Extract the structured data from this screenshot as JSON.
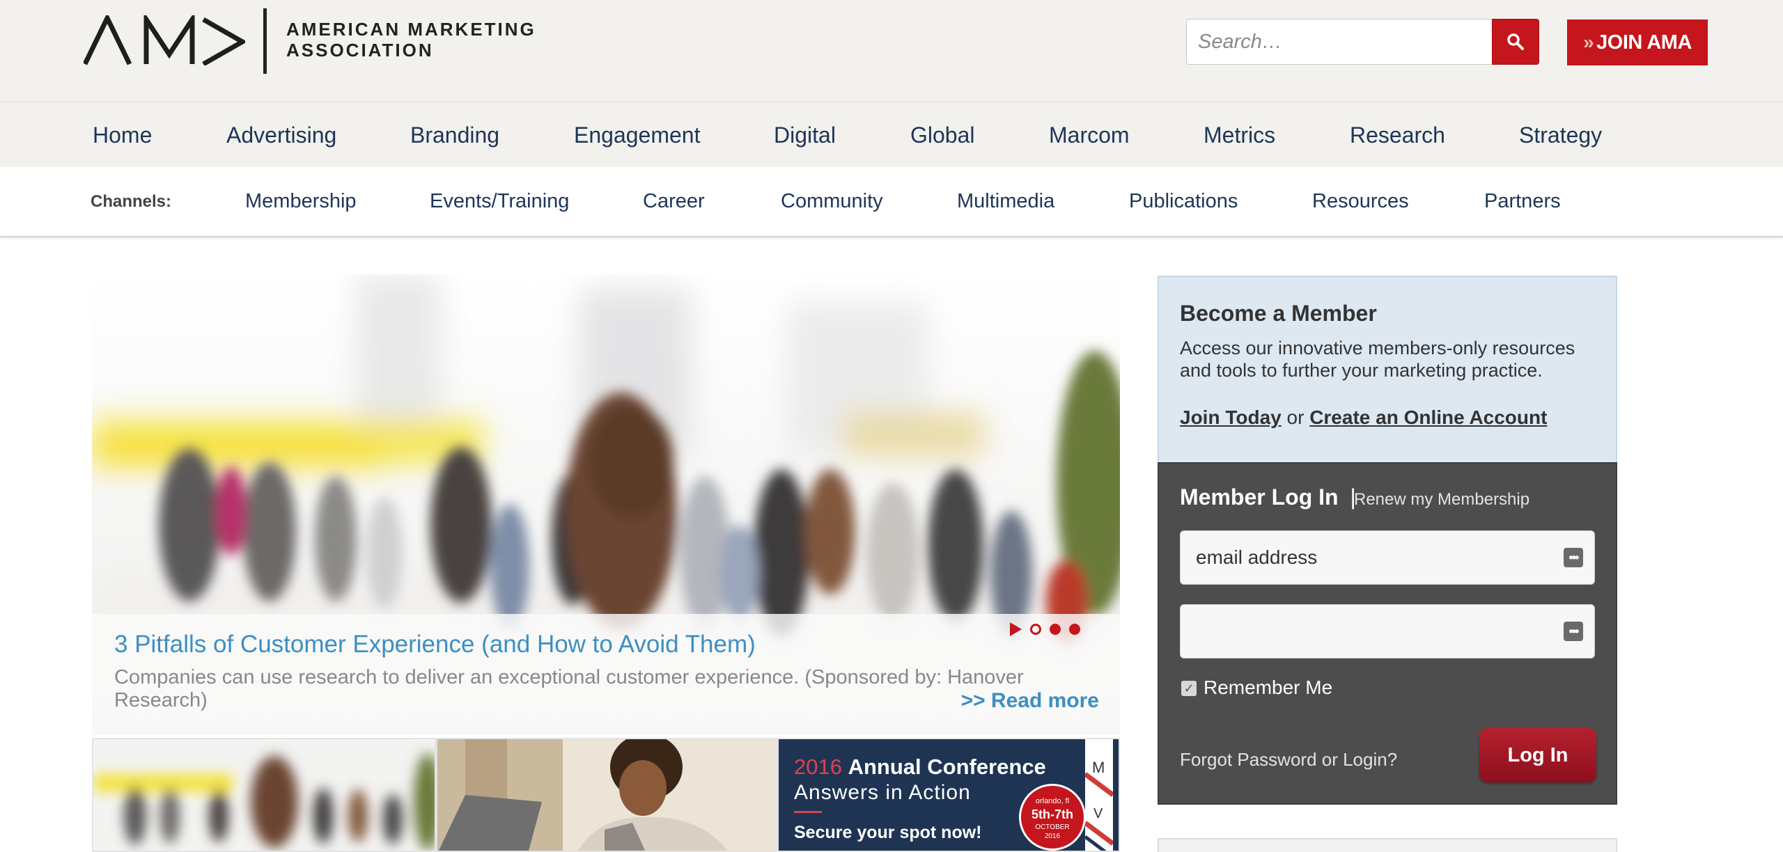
{
  "header": {
    "logo_text_line1": "AMERICAN MARKETING",
    "logo_text_line2": "ASSOCIATION",
    "search_placeholder": "Search…",
    "join_label": "JOIN AMA",
    "brand_color": "#c4161c"
  },
  "main_nav": [
    "Home",
    "Advertising",
    "Branding",
    "Engagement",
    "Digital",
    "Global",
    "Marcom",
    "Metrics",
    "Research",
    "Strategy"
  ],
  "channel_nav": {
    "label": "Channels:",
    "items": [
      "Membership",
      "Events/Training",
      "Career",
      "Community",
      "Multimedia",
      "Publications",
      "Resources",
      "Partners"
    ]
  },
  "hero": {
    "title": "3 Pitfalls of Customer Experience (and How to Avoid Them)",
    "description": "Companies can use research to deliver an exceptional customer experience. (Sponsored by: Hanover Research)",
    "read_more": ">> Read more"
  },
  "conference": {
    "year": "2016",
    "name": "Annual Conference",
    "tagline": "Answers in Action",
    "cta": "Secure your spot now!",
    "badge_location": "orlando, fl",
    "badge_dates": "5th-7th",
    "badge_month": "OCTOBER",
    "badge_year": "2016",
    "side_letter_1": "M",
    "side_letter_2": "V"
  },
  "sidebar": {
    "member_title": "Become a Member",
    "member_text": "Access our innovative members-only resources and tools to further your marketing practice.",
    "join_link": "Join Today",
    "or_text": "or",
    "create_link": "Create an Online Account",
    "login_title": "Member Log In",
    "login_sep": "|",
    "renew_link": "Renew my Membership",
    "email_value": "email address",
    "password_value": "",
    "remember_label": "Remember Me",
    "remember_checked": true,
    "forgot_link": "Forgot Password or Login?",
    "login_button": "Log In"
  }
}
